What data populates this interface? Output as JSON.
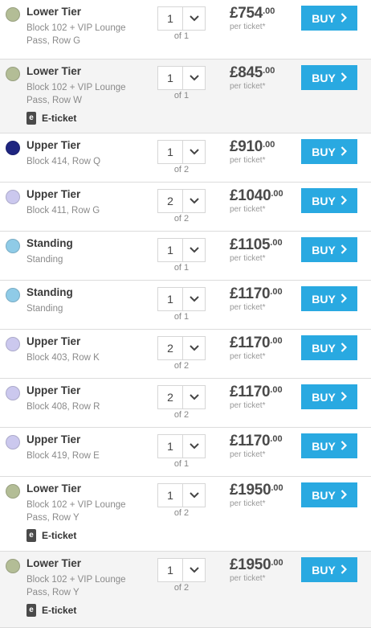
{
  "listings": [
    {
      "color": "#b3bd96",
      "tier": "Lower Tier",
      "loc1": "Block 102 + VIP Lounge",
      "loc2": "Pass, Row G",
      "eticket": "",
      "qty": "1",
      "of": "of 1",
      "amount": "£754",
      "cents": ".00",
      "per": "per ticket*",
      "buy": "BUY"
    },
    {
      "color": "#b3bd96",
      "tier": "Lower Tier",
      "loc1": "Block 102 + VIP Lounge",
      "loc2": "Pass, Row W",
      "eticket": "E-ticket",
      "qty": "1",
      "of": "of 1",
      "amount": "£845",
      "cents": ".00",
      "per": "per ticket*",
      "buy": "BUY"
    },
    {
      "color": "#1f2580",
      "tier": "Upper Tier",
      "loc1": "Block 414, Row Q",
      "loc2": "",
      "eticket": "",
      "qty": "1",
      "of": "of 2",
      "amount": "£910",
      "cents": ".00",
      "per": "per ticket*",
      "buy": "BUY"
    },
    {
      "color": "#cbc8ee",
      "tier": "Upper Tier",
      "loc1": "Block 411, Row G",
      "loc2": "",
      "eticket": "",
      "qty": "2",
      "of": "of 2",
      "amount": "£1040",
      "cents": ".00",
      "per": "per ticket*",
      "buy": "BUY"
    },
    {
      "color": "#8fcbe7",
      "tier": "Standing",
      "loc1": "Standing",
      "loc2": "",
      "eticket": "",
      "qty": "1",
      "of": "of 1",
      "amount": "£1105",
      "cents": ".00",
      "per": "per ticket*",
      "buy": "BUY"
    },
    {
      "color": "#8fcbe7",
      "tier": "Standing",
      "loc1": "Standing",
      "loc2": "",
      "eticket": "",
      "qty": "1",
      "of": "of 1",
      "amount": "£1170",
      "cents": ".00",
      "per": "per ticket*",
      "buy": "BUY"
    },
    {
      "color": "#cbc8ee",
      "tier": "Upper Tier",
      "loc1": "Block 403, Row K",
      "loc2": "",
      "eticket": "",
      "qty": "2",
      "of": "of 2",
      "amount": "£1170",
      "cents": ".00",
      "per": "per ticket*",
      "buy": "BUY"
    },
    {
      "color": "#cbc8ee",
      "tier": "Upper Tier",
      "loc1": "Block 408, Row R",
      "loc2": "",
      "eticket": "",
      "qty": "2",
      "of": "of 2",
      "amount": "£1170",
      "cents": ".00",
      "per": "per ticket*",
      "buy": "BUY"
    },
    {
      "color": "#cbc8ee",
      "tier": "Upper Tier",
      "loc1": "Block 419, Row E",
      "loc2": "",
      "eticket": "",
      "qty": "1",
      "of": "of 1",
      "amount": "£1170",
      "cents": ".00",
      "per": "per ticket*",
      "buy": "BUY"
    },
    {
      "color": "#b3bd96",
      "tier": "Lower Tier",
      "loc1": "Block 102 + VIP Lounge",
      "loc2": "Pass, Row Y",
      "eticket": "E-ticket",
      "qty": "1",
      "of": "of 2",
      "amount": "£1950",
      "cents": ".00",
      "per": "per ticket*",
      "buy": "BUY"
    },
    {
      "color": "#b3bd96",
      "tier": "Lower Tier",
      "loc1": "Block 102 + VIP Lounge",
      "loc2": "Pass, Row Y",
      "eticket": "E-ticket",
      "qty": "1",
      "of": "of 2",
      "amount": "£1950",
      "cents": ".00",
      "per": "per ticket*",
      "buy": "BUY"
    }
  ],
  "eticket_icon_letter": "e",
  "chevron_glyph": "›"
}
